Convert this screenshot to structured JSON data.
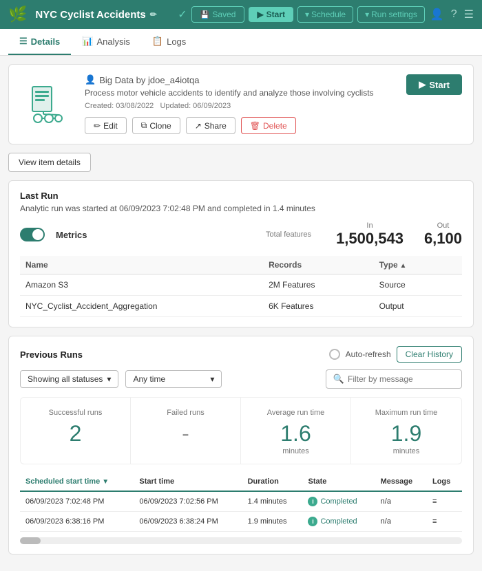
{
  "topbar": {
    "logo": "🌿",
    "title": "NYC Cyclist Accidents",
    "edit_icon": "✏",
    "saved_label": "Saved",
    "start_label": "Start",
    "schedule_label": "Schedule",
    "run_settings_label": "Run settings",
    "check_icon": "✓",
    "play_icon": "▶",
    "chevron_down": "▾"
  },
  "tabs": [
    {
      "label": "Details",
      "icon": "☰",
      "active": true
    },
    {
      "label": "Analysis",
      "icon": "📊",
      "active": false
    },
    {
      "label": "Logs",
      "icon": "📋",
      "active": false
    }
  ],
  "info_card": {
    "owner_icon": "👤",
    "owner_label": "Big Data by jdoe_a4iotqa",
    "description": "Process motor vehicle accidents to identify and analyze those involving cyclists",
    "created": "Created: 03/08/2022",
    "updated": "Updated: 06/09/2023",
    "btn_edit": "Edit",
    "btn_clone": "Clone",
    "btn_share": "Share",
    "btn_delete": "Delete",
    "btn_start": "Start"
  },
  "view_details_btn": "View item details",
  "last_run": {
    "title": "Last Run",
    "subtitle": "Analytic run was started at 06/09/2023 7:02:48 PM and completed in 1.4 minutes",
    "metrics_label": "Metrics",
    "total_features_label": "Total features",
    "in_label": "In",
    "out_label": "Out",
    "total_value": "",
    "in_value": "1,500,543",
    "out_value": "6,100",
    "table": {
      "headers": [
        "Name",
        "Records",
        "Type"
      ],
      "rows": [
        {
          "name": "Amazon S3",
          "records": "2M Features",
          "type": "Source"
        },
        {
          "name": "NYC_Cyclist_Accident_Aggregation",
          "records": "6K Features",
          "type": "Output"
        }
      ]
    }
  },
  "previous_runs": {
    "title": "Previous Runs",
    "auto_refresh_label": "Auto-refresh",
    "clear_history_label": "Clear History",
    "filter_status_label": "Showing all statuses",
    "filter_time_label": "Any time",
    "filter_placeholder": "Filter by message",
    "stats": [
      {
        "label": "Successful runs",
        "value": "2",
        "unit": ""
      },
      {
        "label": "Failed runs",
        "value": "-",
        "unit": ""
      },
      {
        "label": "Average run time",
        "value": "1.6",
        "unit": "minutes"
      },
      {
        "label": "Maximum run time",
        "value": "1.9",
        "unit": "minutes"
      }
    ],
    "table": {
      "headers": [
        "Scheduled start time",
        "Start time",
        "Duration",
        "State",
        "Message",
        "Logs"
      ],
      "rows": [
        {
          "scheduled": "06/09/2023 7:02:48 PM",
          "start": "06/09/2023 7:02:56 PM",
          "duration": "1.4 minutes",
          "state": "Completed",
          "message": "n/a",
          "logs": "≡"
        },
        {
          "scheduled": "06/09/2023 6:38:16 PM",
          "start": "06/09/2023 6:38:24 PM",
          "duration": "1.9 minutes",
          "state": "Completed",
          "message": "n/a",
          "logs": "≡"
        }
      ]
    }
  }
}
